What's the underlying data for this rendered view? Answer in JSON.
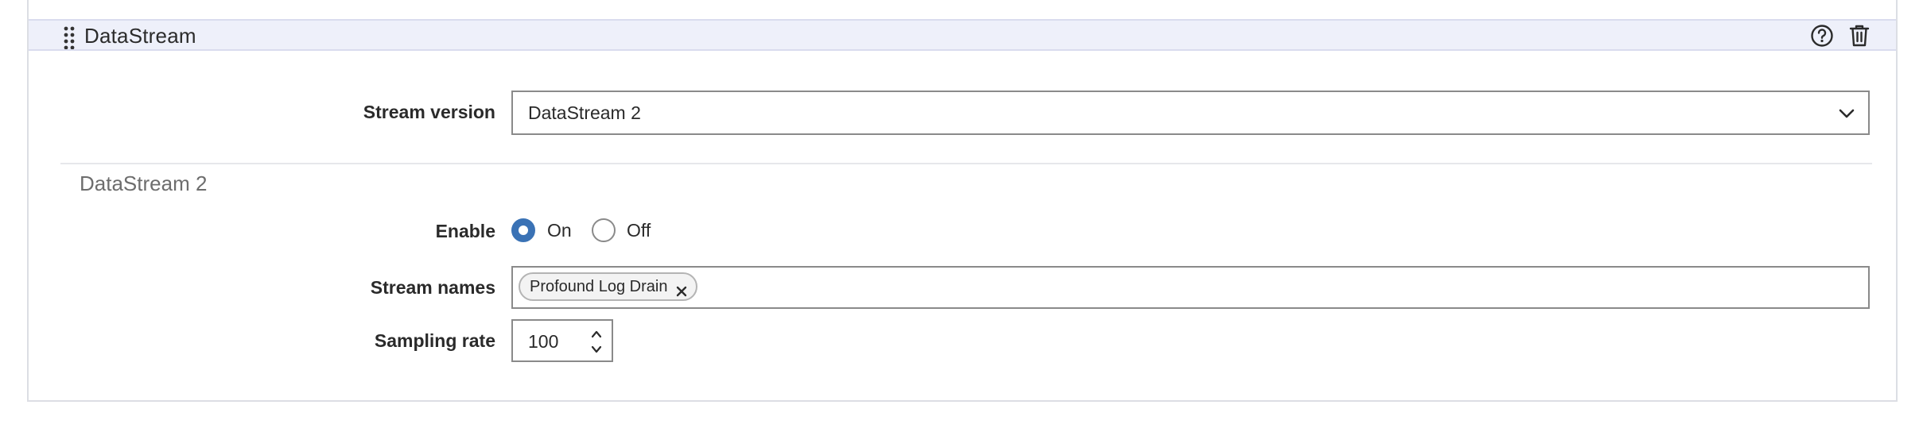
{
  "section": {
    "title": "DataStream",
    "icons": {
      "drag": "drag-handle-icon",
      "help": "help-circle-icon",
      "delete": "trash-icon"
    }
  },
  "stream_version": {
    "label": "Stream version",
    "selected": "DataStream 2",
    "icon": "chevron-down-icon"
  },
  "subsection": {
    "title": "DataStream 2"
  },
  "enable": {
    "label": "Enable",
    "options": [
      {
        "label": "On",
        "checked": true
      },
      {
        "label": "Off",
        "checked": false
      }
    ]
  },
  "stream_names": {
    "label": "Stream names",
    "tags": [
      {
        "label": "Profound Log Drain",
        "remove_icon": "close-icon"
      }
    ]
  },
  "sampling_rate": {
    "label": "Sampling rate",
    "value": "100",
    "icon": "spinner-arrows-icon"
  },
  "colors": {
    "accent": "#3a72b5",
    "header_bg": "#eef0fa",
    "border": "#8a8a8a"
  }
}
